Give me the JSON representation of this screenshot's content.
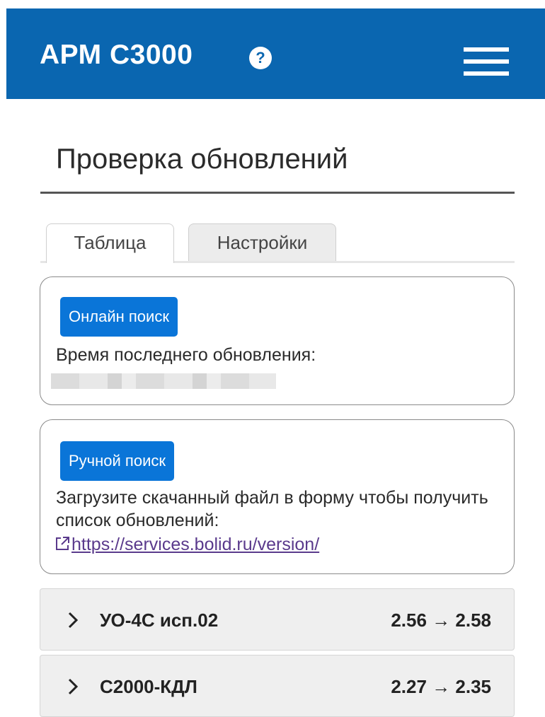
{
  "header": {
    "app_title": "АРМ С3000",
    "help_glyph": "?",
    "brand_color": "#0a66b0"
  },
  "page": {
    "title": "Проверка обновлений"
  },
  "tabs": [
    {
      "label": "Таблица",
      "active": true
    },
    {
      "label": "Настройки",
      "active": false
    }
  ],
  "online_card": {
    "button_label": "Онлайн поиск",
    "text": "Время последнего обновления:"
  },
  "manual_card": {
    "button_label": "Ручной поиск",
    "text": "Загрузите скачанный файл в форму чтобы получить список обновлений:",
    "link_text": "https://services.bolid.ru/version/"
  },
  "updates": [
    {
      "name": "УО-4С исп.02",
      "version": "2.56 → 2.58"
    },
    {
      "name": "С2000-КДЛ",
      "version": "2.27 → 2.35"
    }
  ],
  "icons": {
    "menu": "hamburger-icon",
    "help": "question-circle-icon",
    "external_link": "external-link-icon",
    "chevron": "chevron-right-icon"
  },
  "colors": {
    "primary_button": "#0a75d8",
    "link": "#5a3a8c",
    "accordion_bg": "#efefef"
  }
}
